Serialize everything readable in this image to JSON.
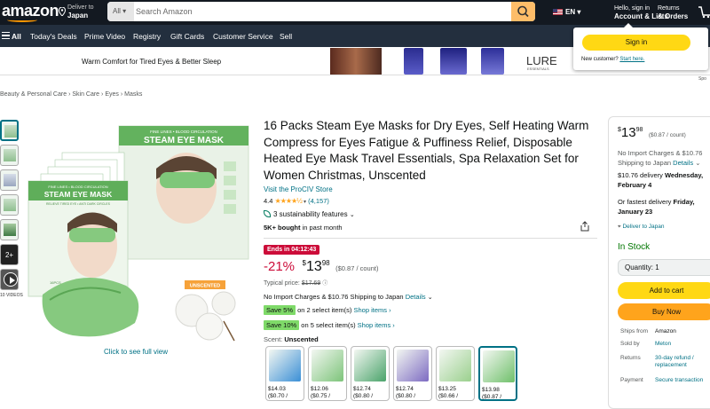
{
  "header": {
    "logo": "amazon",
    "deliver_line1": "Deliver to",
    "deliver_line2": "Japan",
    "search_category": "All",
    "search_placeholder": "Search Amazon",
    "language": "EN",
    "account_line1": "Hello, sign in",
    "account_line2": "Account & Lists",
    "returns_line1": "Returns",
    "returns_line2": "& Orders"
  },
  "nav": {
    "all": "All",
    "items": [
      "Today's Deals",
      "Prime Video",
      "Registry",
      "Gift Cards",
      "Customer Service",
      "Sell"
    ]
  },
  "banner": {
    "text": "Warm Comfort for Tired Eyes & Better Sleep",
    "sponsored": "Spo"
  },
  "signin_popup": {
    "button": "Sign in",
    "new_customer": "New customer?",
    "start_here": "Start here."
  },
  "breadcrumb": [
    "Beauty & Personal Care",
    "Skin Care",
    "Eyes",
    "Masks"
  ],
  "gallery": {
    "thumb_count_label": "2+",
    "videos_label": "10 VIDEOS",
    "full_view": "Click to see full view",
    "box_line1": "FINE LINES • BLOOD CIRCULATION",
    "box_title": "STEAM EYE MASK",
    "box_line2": "RELIEVE TIRED EYE • ANTI DARK CIRCLES",
    "box_count": "16PCS",
    "box_scent": "UNSCENTED"
  },
  "product": {
    "title": "16 Packs Steam Eye Masks for Dry Eyes, Self Heating Warm Compress for Eyes Fatigue & Puffiness Relief, Disposable Heated Eye Mask Travel Essentials, Spa Relaxation Set for Women Christmas, Unscented",
    "store": "Visit the ProCIV Store",
    "rating": "4.4",
    "stars": "★★★★½",
    "review_count": "(4,157)",
    "sustainability": "3 sustainability features",
    "bought_bold": "5K+ bought",
    "bought_rest": "in past month",
    "deal_timer": "Ends in 04:12:43",
    "discount": "-21%",
    "price_symbol": "$",
    "price_whole": "13",
    "price_fraction": "98",
    "price_unit": "($0.87 / count)",
    "typical_label": "Typical price:",
    "typical_value": "$17.69",
    "import_text": "No Import Charges & $10.76 Shipping to Japan",
    "import_link": "Details",
    "coupon1_tag": "Save 5%",
    "coupon1_text": "on 2 select item(s)",
    "coupon1_link": "Shop items ›",
    "coupon2_tag": "Save 10%",
    "coupon2_text": "on 5 select item(s)",
    "coupon2_link": "Shop items ›",
    "scent_label": "Scent:",
    "scent_value": "Unscented"
  },
  "swatches": [
    {
      "price": "$14.03",
      "unit": "($0.70 /",
      "color": "#3b8fd6"
    },
    {
      "price": "$12.06",
      "unit": "($0.75 /",
      "color": "#7dc47a"
    },
    {
      "price": "$12.74",
      "unit": "($0.80 /",
      "color": "#4aa36a"
    },
    {
      "price": "$12.74",
      "unit": "($0.80 /",
      "color": "#7d6bc2"
    },
    {
      "price": "$13.25",
      "unit": "($0.66 /",
      "color": "#9ad08d"
    },
    {
      "price": "$13.98",
      "unit": "($0.87 /",
      "color": "#6fc06a"
    }
  ],
  "buybox": {
    "price_symbol": "$",
    "price_whole": "13",
    "price_fraction": "98",
    "price_unit": "($0.87 / count)",
    "import_line1": "No Import Charges & $10.76",
    "import_line2_text": "Shipping to Japan",
    "import_line2_link": "Details",
    "delivery_line1_plain": "$10.76 delivery",
    "delivery_line1_bold": "Wednesday,",
    "delivery_line2_bold": "February 4",
    "fastest_plain": "Or fastest delivery",
    "fastest_bold1": "Friday,",
    "fastest_bold2": "January 23",
    "deliver_to": "Deliver to Japan",
    "in_stock": "In Stock",
    "quantity": "Quantity: 1",
    "add_to_cart": "Add to cart",
    "buy_now": "Buy Now",
    "ships_from_label": "Ships from",
    "ships_from_value": "Amazon",
    "sold_by_label": "Sold by",
    "sold_by_value": "Meton",
    "returns_label": "Returns",
    "returns_value1": "30-day refund /",
    "returns_value2": "replacement",
    "payment_label": "Payment",
    "payment_value": "Secure transaction"
  }
}
